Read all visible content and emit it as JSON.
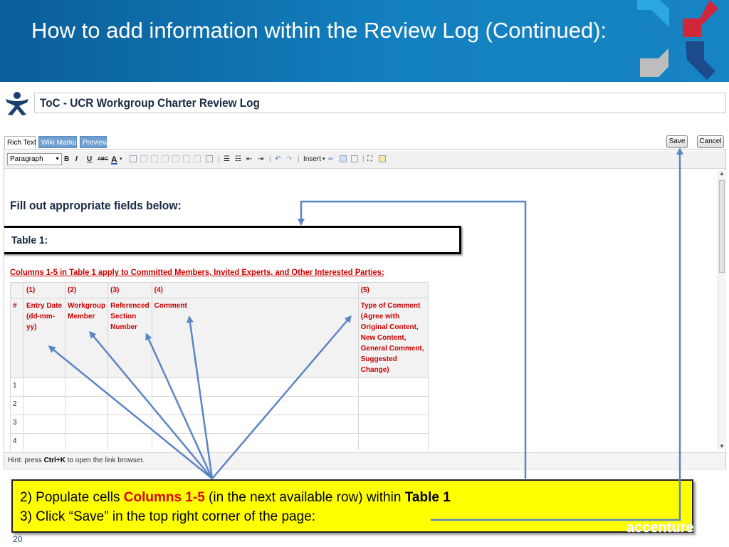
{
  "slide": {
    "title": "How to add information within the Review Log (Continued):",
    "page_number": "20",
    "watermark": "accenture"
  },
  "colors": {
    "header_blue": "#1380c0",
    "callout_yellow": "#ffff00",
    "note_red": "#cc0000",
    "arrow_blue": "#5b85c4"
  },
  "wiki": {
    "page_title": "ToC - UCR Workgroup Charter Review Log",
    "tabs": [
      "Rich Text",
      "Wiki Markup",
      "Preview"
    ],
    "save_label": "Save",
    "cancel_label": "Cancel",
    "paragraph_select": "Paragraph",
    "insert_label": "Insert",
    "hint": {
      "prefix": "Hint: press ",
      "shortcut": "Ctrl+K",
      "suffix": " to open the link browser."
    }
  },
  "content": {
    "heading": "Fill out appropriate fields below:",
    "table_label": "Table 1:",
    "columns_note": "Columns 1-5 in Table 1 apply to Committed Members, Invited Experts, and Other Interested Parties:",
    "table": {
      "col_numbers": [
        "",
        "(1)",
        "(2)",
        "(3)",
        "(4)",
        "(5)"
      ],
      "col_headers": [
        "#",
        "Entry Date (dd-mm-yy)",
        "Workgroup Member",
        "Referenced Section Number",
        "Comment",
        "Type of Comment (Agree with Original Content, New Content, General Comment, Suggested Change)"
      ],
      "rows": [
        "1",
        "2",
        "3",
        "4"
      ]
    }
  },
  "callout": {
    "line1_prefix": "2) Populate cells ",
    "line1_red": "Columns 1-5",
    "line1_mid": " (in the next available row) within ",
    "line1_bold": "Table 1",
    "line2": "3) Click “Save” in the top right corner of the page:"
  }
}
